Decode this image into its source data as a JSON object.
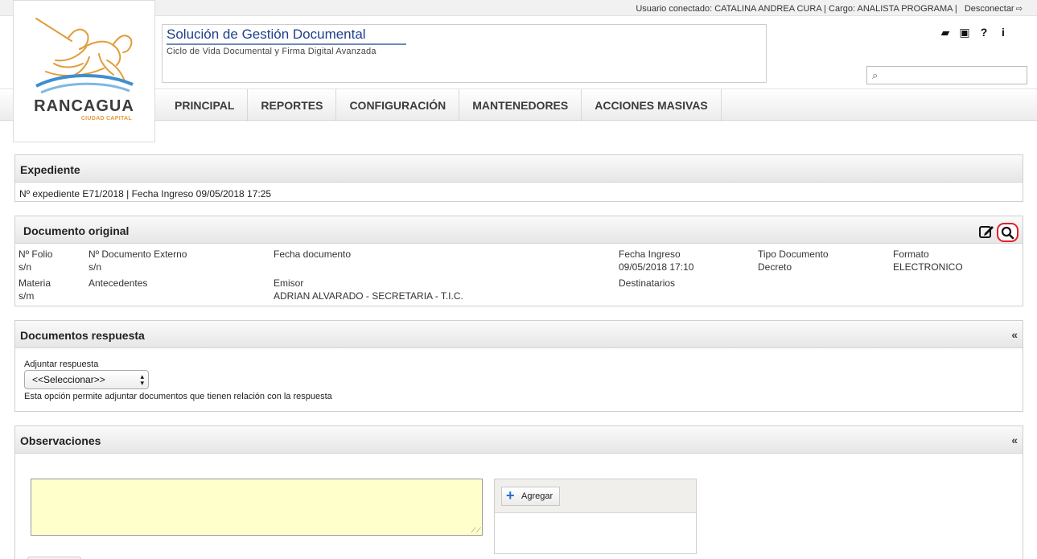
{
  "topbar": {
    "user_info": "Usuario conectado: CATALINA ANDREA CURA | Cargo: ANALISTA PROGRAMA |",
    "logout": "Desconectar"
  },
  "logo": {
    "name": "RANCAGUA",
    "subtitle": "CIUDAD CAPITAL",
    "color": "#e39c3a"
  },
  "header": {
    "title": "Solución de Gestión Documental",
    "subtitle": "Ciclo de Vida Documental y Firma Digital Avanzada",
    "icons": [
      "book-icon",
      "news-icon",
      "help-icon",
      "info-icon"
    ],
    "icon_glyphs": [
      "▰",
      "▣",
      "?",
      "i"
    ]
  },
  "nav": {
    "items": [
      "PRINCIPAL",
      "REPORTES",
      "CONFIGURACIÓN",
      "MANTENEDORES",
      "ACCIONES MASIVAS"
    ]
  },
  "expediente": {
    "title": "Expediente",
    "line": "Nº expediente  E71/2018  |  Fecha Ingreso 09/05/2018 17:25"
  },
  "documento_original": {
    "title": "Documento original",
    "folio_label": "Nº Folio",
    "folio_value": "s/n",
    "doc_externo_label": "Nº Documento Externo",
    "doc_externo_value": "s/n",
    "fecha_doc_label": "Fecha documento",
    "fecha_ingreso_label": "Fecha Ingreso",
    "fecha_ingreso_value": "09/05/2018 17:10",
    "tipo_label": "Tipo Documento",
    "tipo_value": "Decreto",
    "formato_label": "Formato",
    "formato_value": "ELECTRONICO",
    "materia_label": "Materia",
    "materia_value": "s/m",
    "antecedentes_label": "Antecedentes",
    "emisor_label": "Emisor",
    "emisor_value": "ADRIAN ALVARADO - SECRETARIA - T.I.C.",
    "destinatarios_label": "Destinatarios",
    "highlight_color": "#e0202a"
  },
  "respuesta": {
    "title": "Documentos respuesta",
    "collapse": "«",
    "adjuntar_label": "Adjuntar respuesta",
    "select_value": "<<Seleccionar>>",
    "help": "Esta opción permite adjuntar documentos que tienen relación con la respuesta"
  },
  "observaciones": {
    "title": "Observaciones",
    "collapse": "«",
    "add_button": "Agregar",
    "textarea_color": "#ffffcc"
  }
}
